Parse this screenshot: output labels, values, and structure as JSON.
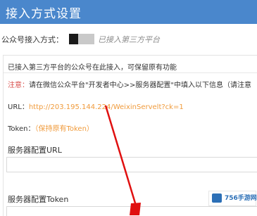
{
  "header": {
    "title": "接入方式设置"
  },
  "access_mode": {
    "label": "公众号接入方式：",
    "status": "已接入第三方平台"
  },
  "panel": {
    "intro": "已接入第三方平台的公众号在此接入，可保留原有功能",
    "notice_key": "注意：",
    "notice_text": "请在微信公众平台\"开发者中心>>服务器配置\"中填入以下信息（请注意",
    "url_label": "URL：",
    "url_value": "http://203.195.144.224/WeixinServelt?ck=1",
    "token_label": "Token：",
    "token_value": "（保持原有Token）"
  },
  "fields": {
    "server_url_label": "服务器配置URL",
    "server_token_label": "服务器配置Token"
  },
  "watermark": {
    "text": "756手游网"
  },
  "colors": {
    "header_bg": "#4a87cc",
    "notice": "#d9534f",
    "highlight": "#f09b3c",
    "arrow": "#e01010"
  }
}
